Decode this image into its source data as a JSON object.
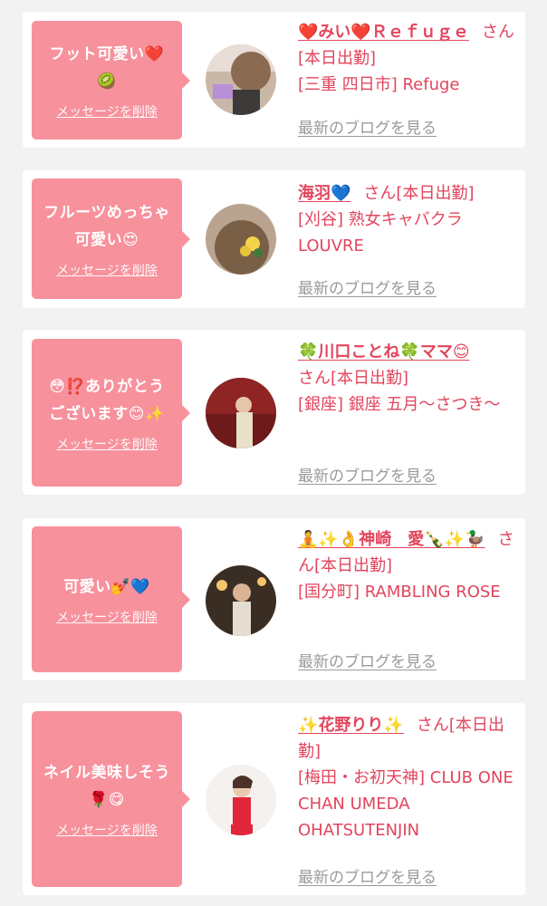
{
  "colors": {
    "background": "#f2f2f2",
    "bubble": "#f7919c",
    "accent_text": "#e2455d",
    "link_gray": "#9a9a9a"
  },
  "cards": [
    {
      "message": "フット可愛い❤️\n🥝",
      "delete_label": "メッセージを削除",
      "name": "❤️みい❤️Ｒｅｆｕｇｅ",
      "honorific": "さん[本日出勤]",
      "store": "[三重 四日市] Refuge",
      "blog_link": "最新のブログを見る"
    },
    {
      "message": "フルーツめっちゃ\n可愛い😍",
      "delete_label": "メッセージを削除",
      "name": "海羽💙",
      "honorific": "さん[本日出勤]",
      "store": "[刈谷] 熟女キャバクラ LOUVRE",
      "blog_link": "最新のブログを見る"
    },
    {
      "message": "😳⁉️ありがとう\nございます😊✨",
      "delete_label": "メッセージを削除",
      "name": "🍀川口ことね🍀ママ😊",
      "honorific": "さん[本日出勤]",
      "store": "[銀座] 銀座 五月～さつき～",
      "blog_link": "最新のブログを見る"
    },
    {
      "message": "可愛い💅💙",
      "delete_label": "メッセージを削除",
      "name": "🧘✨👌神崎　愛🍾✨🦆",
      "honorific": "さん[本日出勤]",
      "store": "[国分町] RAMBLING ROSE",
      "blog_link": "最新のブログを見る"
    },
    {
      "message": "ネイル美味しそう\n🌹😋",
      "delete_label": "メッセージを削除",
      "name": "✨花野りり✨",
      "honorific": "さん[本日出勤]",
      "store": "[梅田・お初天神] CLUB ONE CHAN UMEDA OHATSUTENJIN",
      "blog_link": "最新のブログを見る"
    }
  ]
}
